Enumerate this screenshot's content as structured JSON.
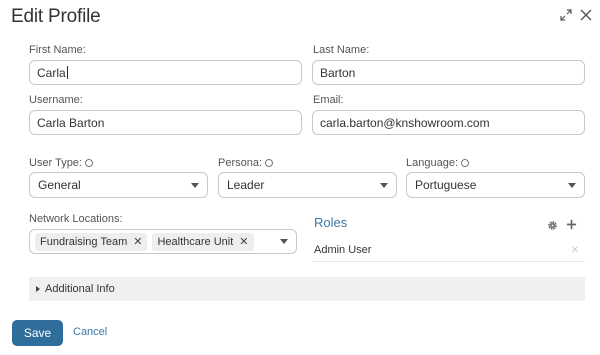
{
  "title": "Edit Profile",
  "header_icons": [
    "expand-icon",
    "close-icon"
  ],
  "fields": {
    "first_name": {
      "label": "First Name:",
      "value": "Carla"
    },
    "last_name": {
      "label": "Last Name:",
      "value": "Barton"
    },
    "username": {
      "label": "Username:",
      "value": "Carla Barton"
    },
    "email": {
      "label": "Email:",
      "value": "carla.barton@knshowroom.com"
    }
  },
  "selects": {
    "user_type": {
      "label": "User Type:",
      "value": "General"
    },
    "persona": {
      "label": "Persona:",
      "value": "Leader"
    },
    "language": {
      "label": "Language:",
      "value": "Portuguese"
    }
  },
  "network_locations": {
    "label": "Network Locations:",
    "tags": [
      "Fundraising Team",
      "Healthcare Unit"
    ]
  },
  "roles": {
    "title": "Roles",
    "items": [
      "Admin User"
    ]
  },
  "additional_info": "Additional Info",
  "buttons": {
    "save": "Save",
    "cancel": "Cancel"
  },
  "colors": {
    "primary": "#2f6d9b",
    "link": "#3a78a8",
    "accordion_bg": "#f0f0f0"
  }
}
